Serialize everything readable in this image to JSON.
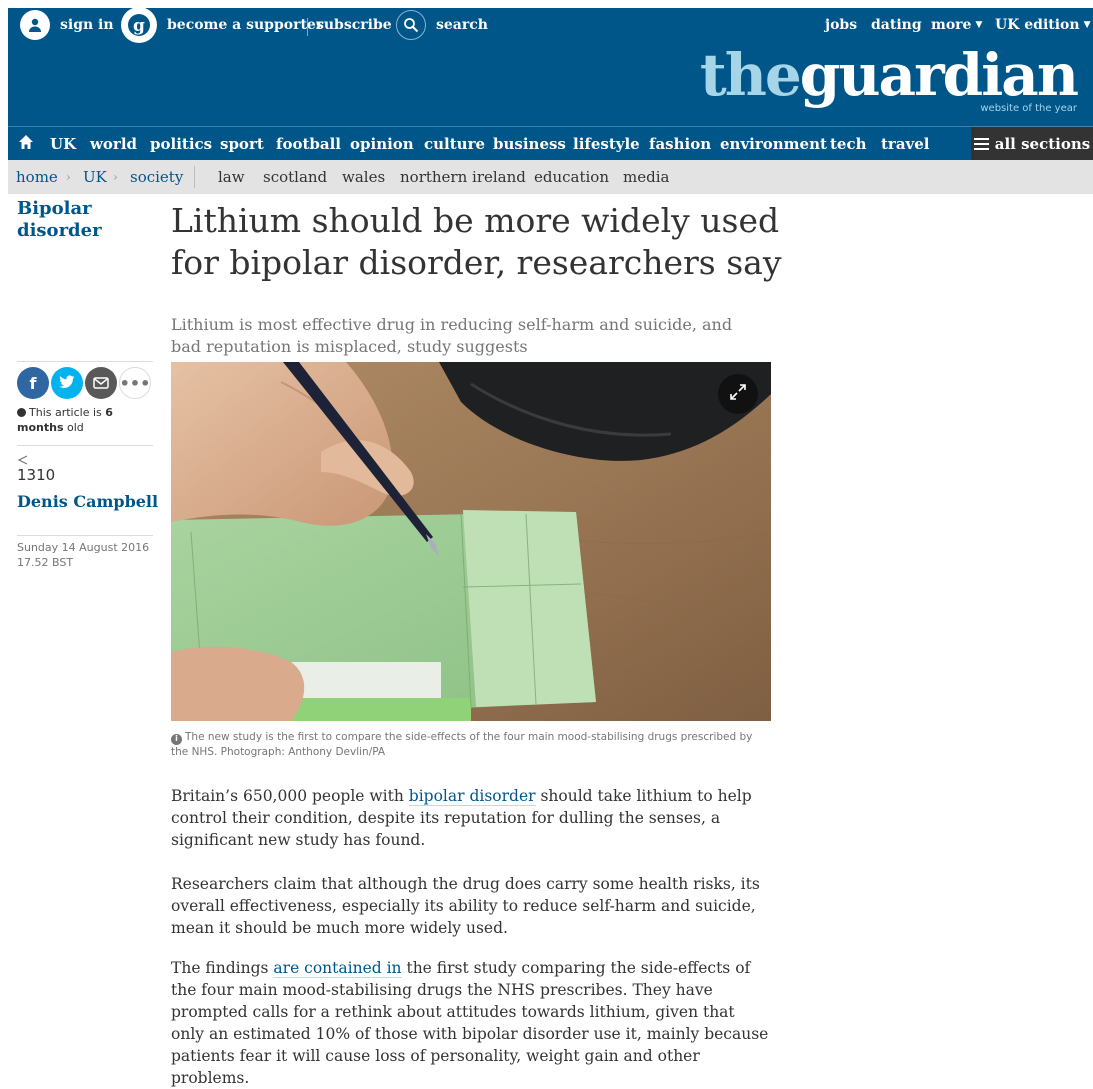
{
  "topbar": {
    "sign_in": "sign in",
    "become_supporter": "become a supporter",
    "subscribe": "subscribe",
    "search": "search",
    "jobs": "jobs",
    "dating": "dating",
    "more": "more",
    "edition": "UK edition"
  },
  "brand": {
    "logo_the": "the",
    "logo_guardian": "guardian",
    "tagline": "website of the year",
    "colors": {
      "masthead": "#005689",
      "logo_light": "#a6d5e8",
      "link": "#005689",
      "facebook": "#3067a3",
      "twitter": "#03b3ee",
      "email": "#595959"
    }
  },
  "nav": {
    "home_icon": "home-icon",
    "items": [
      "UK",
      "world",
      "politics",
      "sport",
      "football",
      "opinion",
      "culture",
      "business",
      "lifestyle",
      "fashion",
      "environment",
      "tech",
      "travel"
    ],
    "all_sections": "all sections"
  },
  "subnav": {
    "breadcrumbs": [
      "home",
      "UK",
      "society"
    ],
    "links": [
      "law",
      "scotland",
      "wales",
      "northern ireland",
      "education",
      "media"
    ]
  },
  "article": {
    "series": "Bipolar disorder",
    "headline": "Lithium should be more widely used for bipolar disorder, researchers say",
    "standfirst": "Lithium is most effective drug in reducing self-harm and suicide, and bad reputation is misplaced, study suggests",
    "age_prefix": "This article is ",
    "age_value": "6 months",
    "age_suffix": " old",
    "share_count": "1310",
    "byline": "Denis Campbell",
    "date": "Sunday 14 August 2016",
    "time": "17.52 BST",
    "caption": "The new study is the first to compare the side-effects of the four main mood-stabilising drugs prescribed by the NHS. Photograph: Anthony Devlin/PA",
    "p1_a": "Britain’s 650,000 people with ",
    "p1_link": "bipolar disorder",
    "p1_b": " should take lithium to help control their condition, despite its reputation for dulling the senses, a significant new study has found.",
    "p2": "Researchers claim that although the drug does carry some health risks, its overall effectiveness, especially its ability to reduce self-harm and suicide, mean it should be much more widely used.",
    "p3_a": "The findings ",
    "p3_link": "are contained in",
    "p3_b": " the first study comparing the side-effects of the four main mood-stabilising drugs the NHS prescribes. They have prompted calls for a rethink about attitudes towards lithium, given that only an estimated 10% of those with bipolar disorder use it, mainly because patients fear it will cause loss of personality, weight gain and other problems."
  }
}
